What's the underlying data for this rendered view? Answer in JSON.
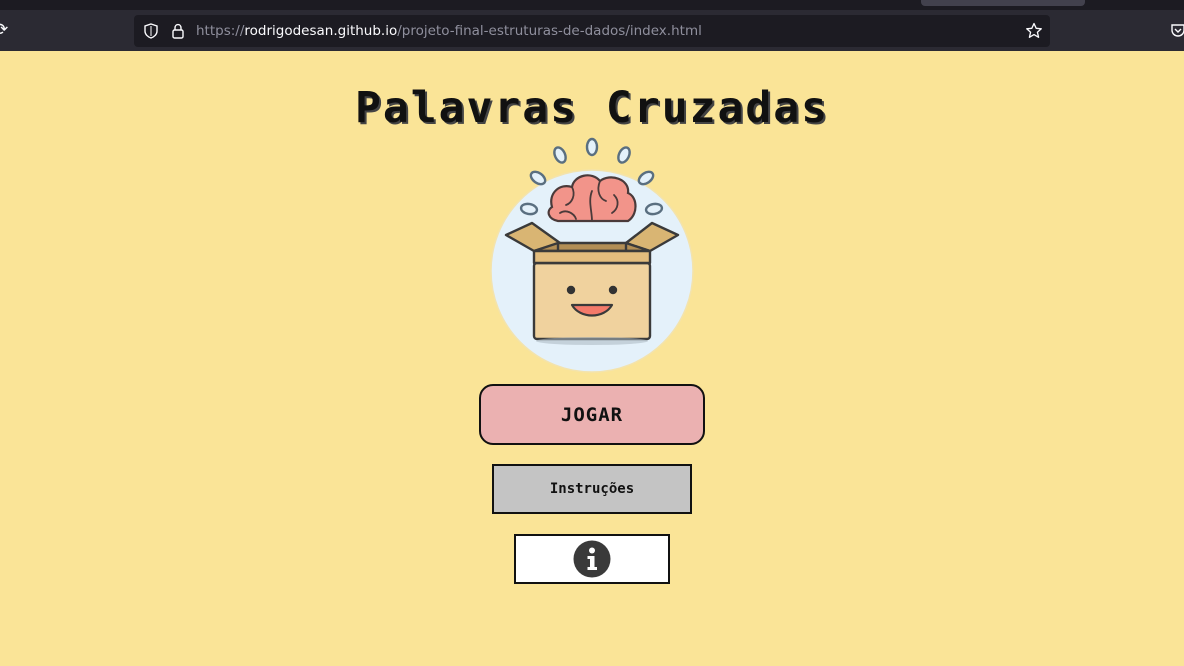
{
  "browser": {
    "url_scheme": "https://",
    "url_host": "rodrigodesan.github.io",
    "url_path": "/projeto-final-estruturas-de-dados/index.html",
    "icons": [
      "reload-icon",
      "shield-icon",
      "lock-icon",
      "bookmark-star-icon",
      "pocket-icon"
    ]
  },
  "page": {
    "title": "Palavras Cruzadas",
    "logo_icon": "brain-box-logo",
    "play_label": "JOGAR",
    "instructions_label": "Instruções",
    "info_icon": "info-icon"
  },
  "colors": {
    "background": "#fae497",
    "play_button": "#ebb1b1",
    "instructions_button": "#c4c4c4",
    "info_button": "#ffffff"
  }
}
